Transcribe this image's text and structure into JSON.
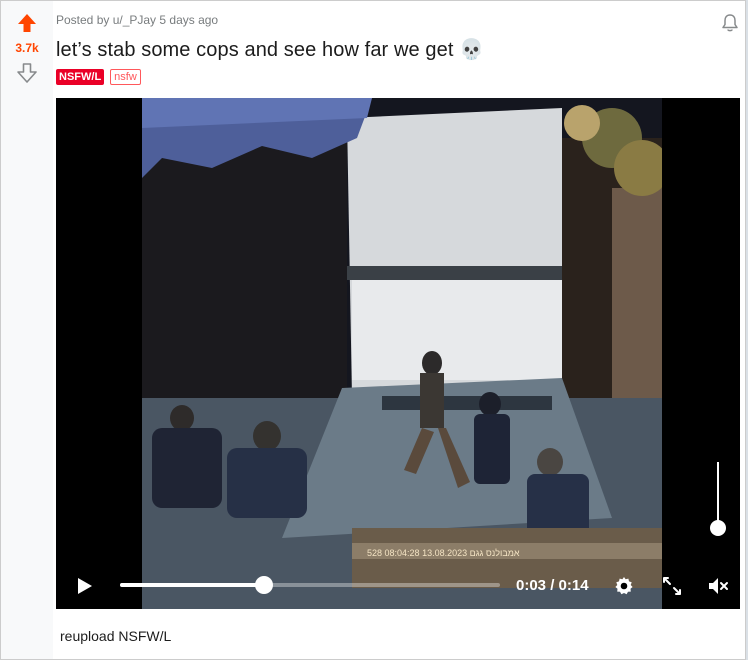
{
  "vote": {
    "score": "3.7k",
    "upvote_icon": "upvote-arrow-icon",
    "downvote_icon": "downvote-arrow-icon"
  },
  "post": {
    "meta": "Posted by u/_PJay 5 days ago",
    "title": "let’s stab some cops and see how far we get 💀",
    "flairs": [
      "NSFW/L",
      "nsfw"
    ],
    "body": "reupload NSFW/L"
  },
  "video": {
    "time": "0:03 / 0:14",
    "progress": 0.38,
    "volume": 0.1,
    "overlay_text": "528 אמבולנס גגם 13.08.2023 08:04:28"
  },
  "colors": {
    "accent": "#ff4500",
    "flair_red": "#ea0027",
    "flair_outline": "#ff585b",
    "meta_gray": "#787c7e"
  }
}
